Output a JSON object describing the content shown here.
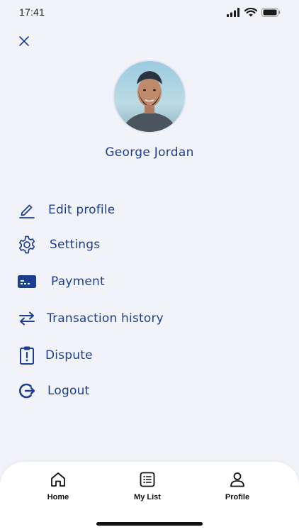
{
  "status_bar": {
    "time": "17:41",
    "icons": [
      "signal-icon",
      "wifi-icon",
      "battery-icon"
    ]
  },
  "header": {
    "close_icon": "close-icon"
  },
  "profile": {
    "name": "George Jordan"
  },
  "menu": {
    "items": [
      {
        "label": "Edit profile",
        "icon": "pencil-icon"
      },
      {
        "label": "Settings",
        "icon": "gear-icon"
      },
      {
        "label": "Payment",
        "icon": "card-icon"
      },
      {
        "label": "Transaction history",
        "icon": "arrows-swap-icon"
      },
      {
        "label": "Dispute",
        "icon": "clipboard-alert-icon"
      },
      {
        "label": "Logout",
        "icon": "logout-icon"
      }
    ]
  },
  "tabbar": {
    "tabs": [
      {
        "label": "Home",
        "icon": "home-icon"
      },
      {
        "label": "My List",
        "icon": "list-icon"
      },
      {
        "label": "Profile",
        "icon": "user-icon"
      }
    ],
    "active": "Profile"
  },
  "colors": {
    "background": "#f2f3f9",
    "accent": "#1d3f8f",
    "tabbar_bg": "#ffffff"
  }
}
